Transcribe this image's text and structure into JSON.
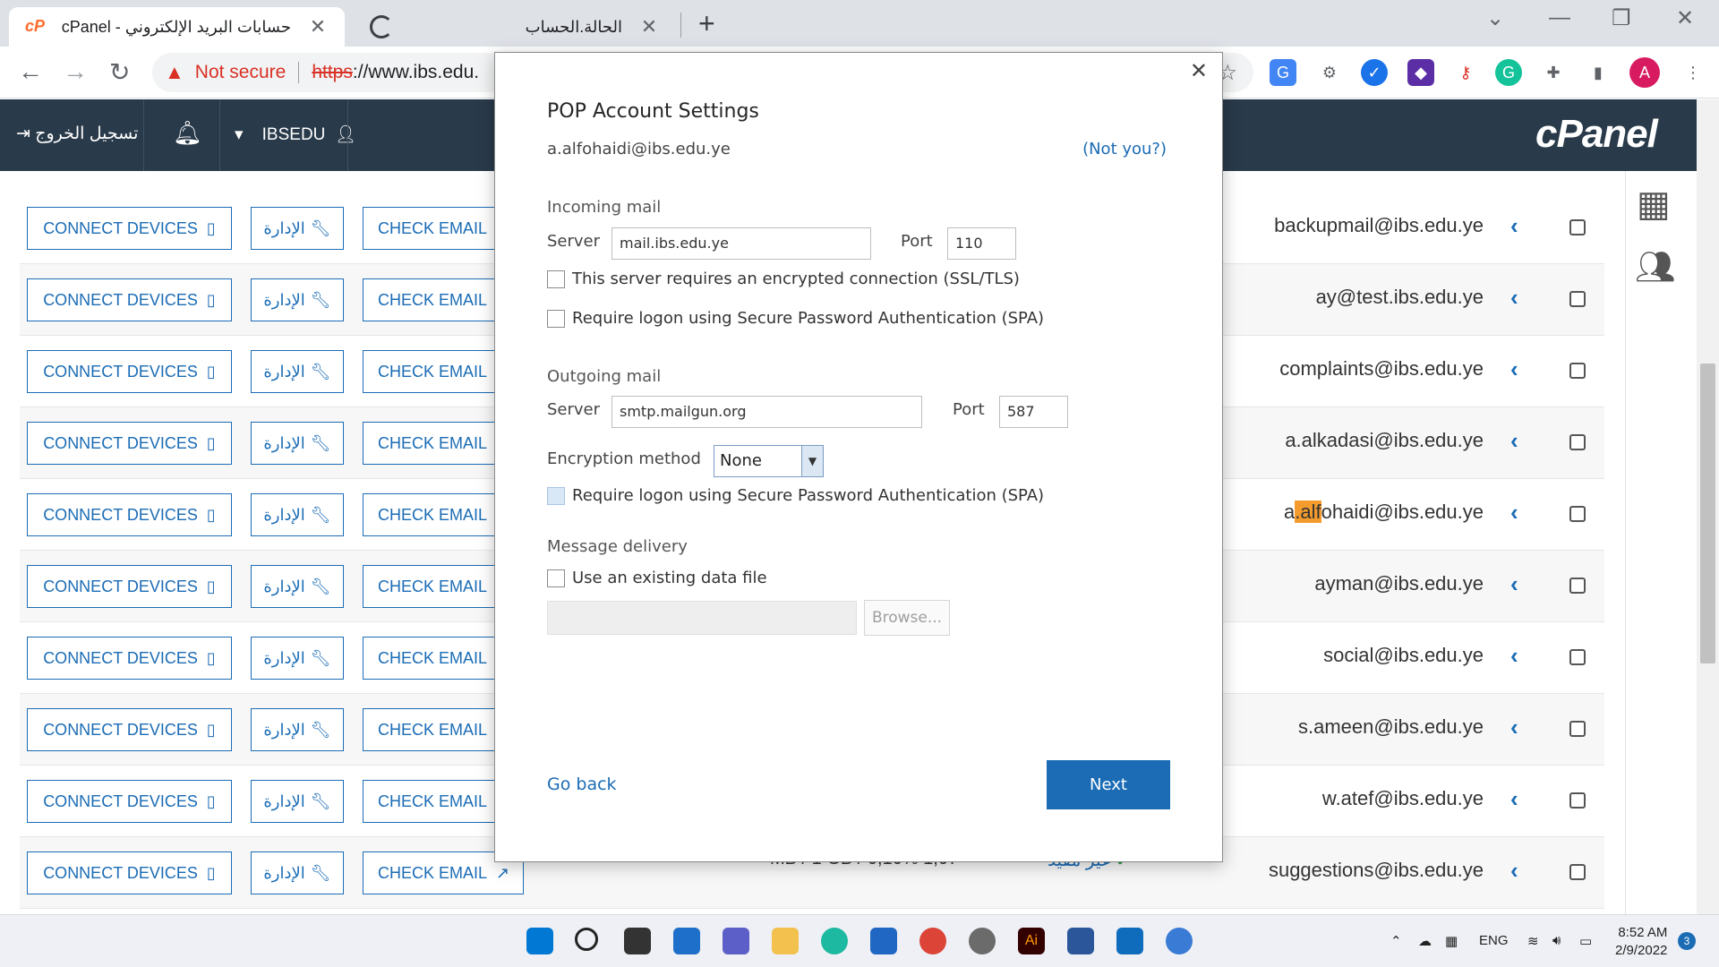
{
  "browser": {
    "tabs": [
      {
        "title": "cPanel - حسابات البريد الإلكتروني",
        "active": true
      },
      {
        "title": "الحالة.الحساب",
        "active": false
      }
    ],
    "security_label": "Not secure",
    "url_scheme": "https",
    "url_rest": "://www.ibs.edu."
  },
  "cpanel": {
    "logout_label": "تسجيل الخروج",
    "username": "IBSEDU",
    "logo": "cPanel",
    "connect_label": "CONNECT DEVICES",
    "manage_label": "الإدارة",
    "check_label": "CHECK EMAIL",
    "rows": [
      {
        "email": "backupmail@ibs.edu.ye"
      },
      {
        "email": "ay@test.ibs.edu.ye"
      },
      {
        "email": "complaints@ibs.edu.ye"
      },
      {
        "email": "a.alkadasi@ibs.edu.ye"
      },
      {
        "email_pre": "a",
        "email_hl": ".alf",
        "email_post": "ohaidi@ibs.edu.ye"
      },
      {
        "email": "ayman@ibs.edu.ye"
      },
      {
        "email": "social@ibs.edu.ye"
      },
      {
        "email": "s.ameen@ibs.edu.ye"
      },
      {
        "email": "w.atef@ibs.edu.ye"
      },
      {
        "email": "suggestions@ibs.edu.ye"
      }
    ],
    "bottom_usage": "MB / 1 GB / 0,10% 1,07",
    "bottom_status": "غير مقيد"
  },
  "dialog": {
    "title": "POP Account Settings",
    "account": "a.alfohaidi@ibs.edu.ye",
    "not_you": "(Not you?)",
    "incoming": {
      "heading": "Incoming mail",
      "server_label": "Server",
      "server": "mail.ibs.edu.ye",
      "port_label": "Port",
      "port": "110",
      "ssl_label": "This server requires an encrypted connection (SSL/TLS)",
      "spa_label": "Require logon using Secure Password Authentication (SPA)"
    },
    "outgoing": {
      "heading": "Outgoing mail",
      "server_label": "Server",
      "server": "smtp.mailgun.org",
      "port_label": "Port",
      "port": "587",
      "encryption_label": "Encryption method",
      "encryption": "None",
      "spa_label": "Require logon using Secure Password Authentication (SPA)"
    },
    "delivery": {
      "heading": "Message delivery",
      "existing_label": "Use an existing data file",
      "browse_label": "Browse..."
    },
    "go_back": "Go back",
    "next": "Next"
  },
  "taskbar": {
    "language": "ENG",
    "time": "8:52 AM",
    "date": "2/9/2022",
    "notifications": "3"
  }
}
